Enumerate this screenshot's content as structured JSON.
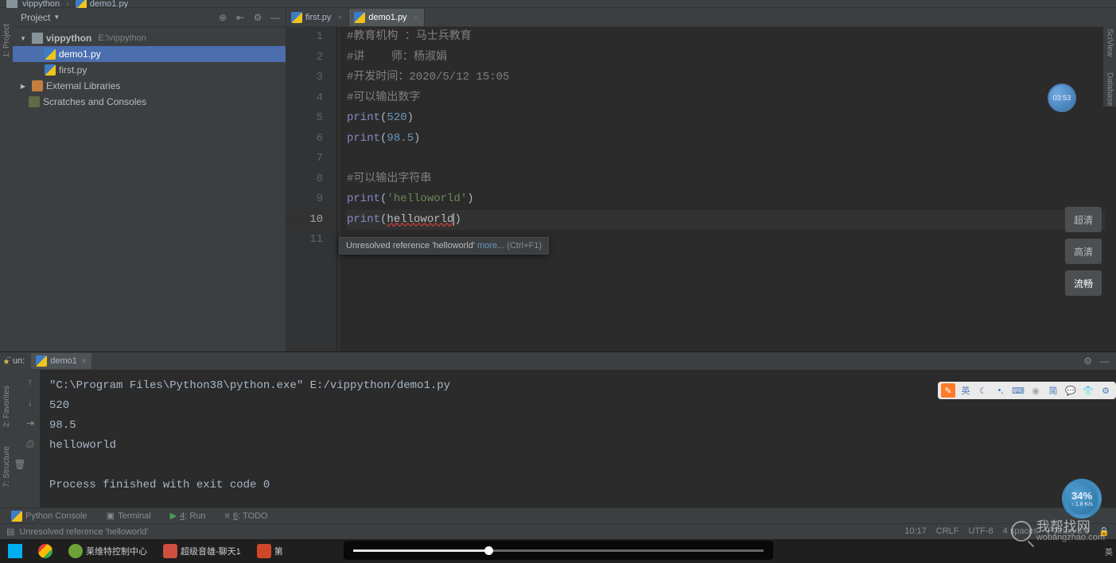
{
  "breadcrumb": {
    "project": "vippython",
    "file": "demo1.py"
  },
  "projectPanel": {
    "title": "Project",
    "tree": {
      "root": {
        "name": "vippython",
        "path": "E:\\vippython"
      },
      "file1": "demo1.py",
      "file2": "first.py",
      "external": "External Libraries",
      "scratches": "Scratches and Consoles"
    }
  },
  "editorTabs": {
    "tab0": "first.py",
    "tab1": "demo1.py"
  },
  "code": {
    "l1": "#教育机构 ：马士兵教育",
    "l2": "#讲    师：杨淑娟",
    "l3": "#开发时间：2020/5/12 15:05",
    "l4": "#可以输出数字",
    "l5_fn": "print",
    "l5_num": "520",
    "l6_fn": "print",
    "l6_num": "98.5",
    "l8": "#可以输出字符串",
    "l9_fn": "print",
    "l9_str": "'helloworld'",
    "l10_fn": "print",
    "l10_err": "helloworld"
  },
  "tooltip": {
    "msg": "Unresolved reference 'helloworld' ",
    "more": "more...",
    "hint": " (Ctrl+F1)"
  },
  "run": {
    "title": "Run:",
    "tabName": "demo1",
    "output": "\"C:\\Program Files\\Python38\\python.exe\" E:/vippython/demo1.py\n520\n98.5\nhelloworld\n\nProcess finished with exit code 0"
  },
  "bottomTabs": {
    "pyconsole": "Python Console",
    "terminal": "Terminal",
    "run": "4: Run",
    "todo": "6: TODO"
  },
  "statusBar": {
    "left": "Unresolved reference 'helloworld'",
    "pos": "10:17",
    "eol": "CRLF",
    "enc": "UTF-8",
    "spaces": "4 spaces",
    "interp": "Python 3.8"
  },
  "taskbar": {
    "item1": "莱维特控制中心",
    "item2": "超级音雄-聊天1",
    "item3": "第"
  },
  "left_vtabs": {
    "project": "1: Project"
  },
  "left_side_vtabs": {
    "favorites": "2: Favorites",
    "structure": "7: Structure"
  },
  "right_vtabs": {
    "sciview": "SciView",
    "database": "Database"
  },
  "quality": {
    "q1": "超清",
    "q2": "高清",
    "q3": "流畅"
  },
  "timer": "03:53",
  "meter": {
    "big": "34%",
    "small": "↑ 1.8 K/s"
  },
  "watermark": {
    "top": "我帮找网",
    "bottom": "wobangzhao.com"
  },
  "ime": {
    "b1": "英",
    "b2": "简"
  },
  "tray": {
    "lang": "英",
    "time": ""
  }
}
